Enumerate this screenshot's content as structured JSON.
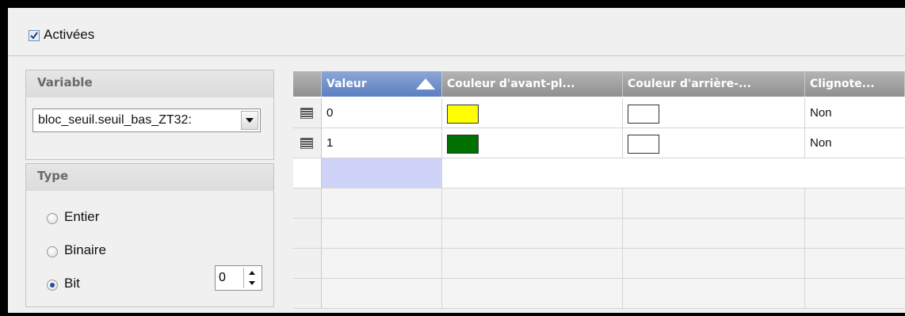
{
  "activation": {
    "label": "Activées",
    "checked": true
  },
  "variable_group": {
    "title": "Variable",
    "selected": "bloc_seuil.seuil_bas_ZT32:"
  },
  "type_group": {
    "title": "Type",
    "options": [
      {
        "label": "Entier",
        "selected": false
      },
      {
        "label": "Binaire",
        "selected": false
      },
      {
        "label": "Bit",
        "selected": true
      }
    ],
    "bit_value": "0"
  },
  "grid": {
    "columns": [
      "Valeur",
      "Couleur d'avant-pl...",
      "Couleur d'arrière-...",
      "Clignote..."
    ],
    "sort_indicator": "sort-ascending-icon",
    "rows": [
      {
        "value": "0",
        "foreground": "#FFFF00",
        "background": "#FFFFFF",
        "blink": "Non"
      },
      {
        "value": "1",
        "foreground": "#007000",
        "background": "#FFFFFF",
        "blink": "Non"
      }
    ]
  }
}
